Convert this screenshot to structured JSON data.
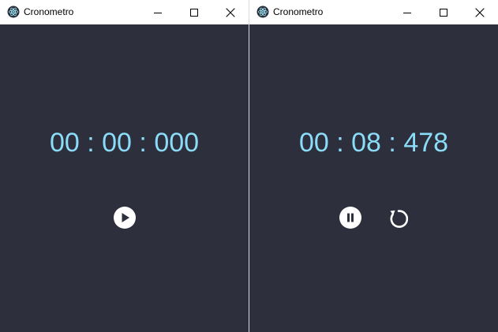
{
  "windows": [
    {
      "title": "Cronometro",
      "time": {
        "minutes": "00",
        "seconds": "00",
        "millis": "000",
        "separator": ":"
      },
      "controls": [
        "play"
      ]
    },
    {
      "title": "Cronometro",
      "time": {
        "minutes": "00",
        "seconds": "08",
        "millis": "478",
        "separator": ":"
      },
      "controls": [
        "pause",
        "reset"
      ]
    }
  ],
  "colors": {
    "background": "#2d2f3c",
    "time_text": "#8adcf8",
    "control": "#ffffff",
    "titlebar": "#ffffff"
  },
  "icons": {
    "app": "atom-icon",
    "minimize": "minimize-icon",
    "maximize": "maximize-icon",
    "close": "close-icon",
    "play": "play-icon",
    "pause": "pause-icon",
    "reset": "reset-icon"
  }
}
